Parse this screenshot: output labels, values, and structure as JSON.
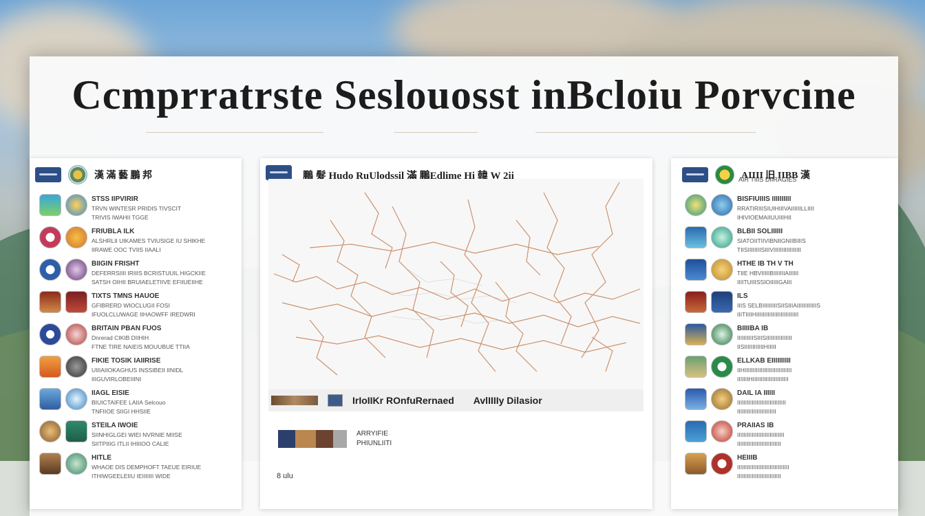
{
  "page_title": "Ccmprratrste Seslouosst inBcloiu Porvcine",
  "left_panel": {
    "header": "漢 滿 藝 鵬 邦",
    "items": [
      {
        "title": "STSS IIPVIRIR",
        "desc": "TRVN WINTESR PRIDIS TIVSCIT",
        "sub": "TRIVIS IWAHII TGGE"
      },
      {
        "title": "FRIUBLA ILK",
        "desc": "ALSHRLII UIKAMES TVIUSIGE IU SHIKHE",
        "sub": "IIRAWE OOC TVIIS IIAALI"
      },
      {
        "title": "BIIGIN FRISHT",
        "desc": "DEFERRSIIII IRIIIS BCRISTUUIL HIGCKIIE",
        "sub": "SATSH OIHII BRUIAELETIIVE EFIIUEIIHE"
      },
      {
        "title": "TIXTS TMNS HAUOE",
        "desc": "GFIBRERD WIOCLUGII FOSI",
        "sub": "IFUOLCLUWAGE IIHAOWFF IREDWRI"
      },
      {
        "title": "BRITAIN PBAN FUOS",
        "desc": "Dnrerad CIKIB DIIHIH",
        "sub": "FTNE TIRE NAIEIS MOUUBUE TTIIA"
      },
      {
        "title": "FIKIE TOSIK IAIIRISE",
        "desc": "UIIIAIIOKAGHUS INSSIBEII IINIDL",
        "sub": "IIIGUVIRLOBEIIINI"
      },
      {
        "title": "IIAGL EISIE",
        "desc": "BIUICTAIFEE LAIIA Selcouo",
        "sub": "TNFIIOE SIIGI HHSIIE"
      },
      {
        "title": "STEILA IWOIE",
        "desc": "SIINHIGLGEI WIEI NVRNIE MIISE",
        "sub": "SIITPIIIG ITLII IHIIIOO CALIE"
      },
      {
        "title": "HITLE",
        "desc": "WHAOE DIS DEMPHOFT TAEUE EIRIUE",
        "sub": "ITHIWGEELEIIU IEIIIIIII WIDE"
      }
    ]
  },
  "center_panel": {
    "map_title": "鵬 髮 Hudo RuUlodssil 滿 鵬Edlime Hi 韓 W 2ii",
    "legend_left": "IrIoIIKr ROnfuRernaed",
    "legend_right": "AvlIIIIy Dilasior",
    "photo_caption_1": "ARRYIFIE",
    "photo_caption_2": "PHIUNLIITI",
    "foot_note": "8 ulu"
  },
  "right_panel": {
    "header": "AIIII 旧 IIBB 漢",
    "header_sub": "AIR TIIIS DIIRAGIES",
    "items": [
      {
        "title": "BISFIUIIIS IIIIIIIIII",
        "desc": "RRATIRIIISIUIHIIIVAIIIIIILLIIII",
        "sub": "IHIVIOEMAIIUUIIIHII"
      },
      {
        "title": "BLBII SOLIIIIII",
        "desc": "SIATOIITIIVIBNIIGNIIBIIIS",
        "sub": "TIISIIIIIIIISIIIVIIIIIIIIIIIIIIIII"
      },
      {
        "title": "HTHE IB TH V TH",
        "desc": "TIIE HBVIIIIIBIIIIIIIAIIIIII",
        "sub": "IIIITUIIISSIOIIIIIGAIII"
      },
      {
        "title": "ILS",
        "desc": "IIIS SELBIIIIIIIIISIISIIIAIIIIIIIIIIIIS",
        "sub": "IIITIIIIHIIIIIIIIIIIIIIIIIIIIIIIIII"
      },
      {
        "title": "BIIIIBA IB",
        "desc": "IIIIIIIIIISIIISIIIIIIIIIIIIIIII",
        "sub": "IISIIIIIIIIIIIIHIIIII"
      },
      {
        "title": "ELLKAB EIIIIIIIIII",
        "desc": "IIHIIIIIIIIIIIIIIIIIIIIIIIIIIIII",
        "sub": "IIIIIIIHIIIIIIIIIIIIIIIIIIIIII"
      },
      {
        "title": "DAIL IA IIIIII",
        "desc": "IIIIIIIIIIIIIIIIIIIIIIIIIIIIII",
        "sub": "IIIIIIIIIIIIIIIIIIIIIIII"
      },
      {
        "title": "PRAIIAS IB",
        "desc": "IIIIIIIIIIIIIIIIIIIIIIIIIIIII",
        "sub": "IIIIIIIIIIIIIIIIIIIIIIIIIII"
      },
      {
        "title": "HEIIIB",
        "desc": "IIIIIIIIIIIIIIIIIIIIIIIIIIIIIIII",
        "sub": "IIIIIIIIIIIIIIIIIIIIIIIIIII"
      }
    ]
  },
  "colors": {
    "map_lines": "#c9875f",
    "title": "#1c1c1c",
    "logo_blue": "#2d4f86"
  }
}
